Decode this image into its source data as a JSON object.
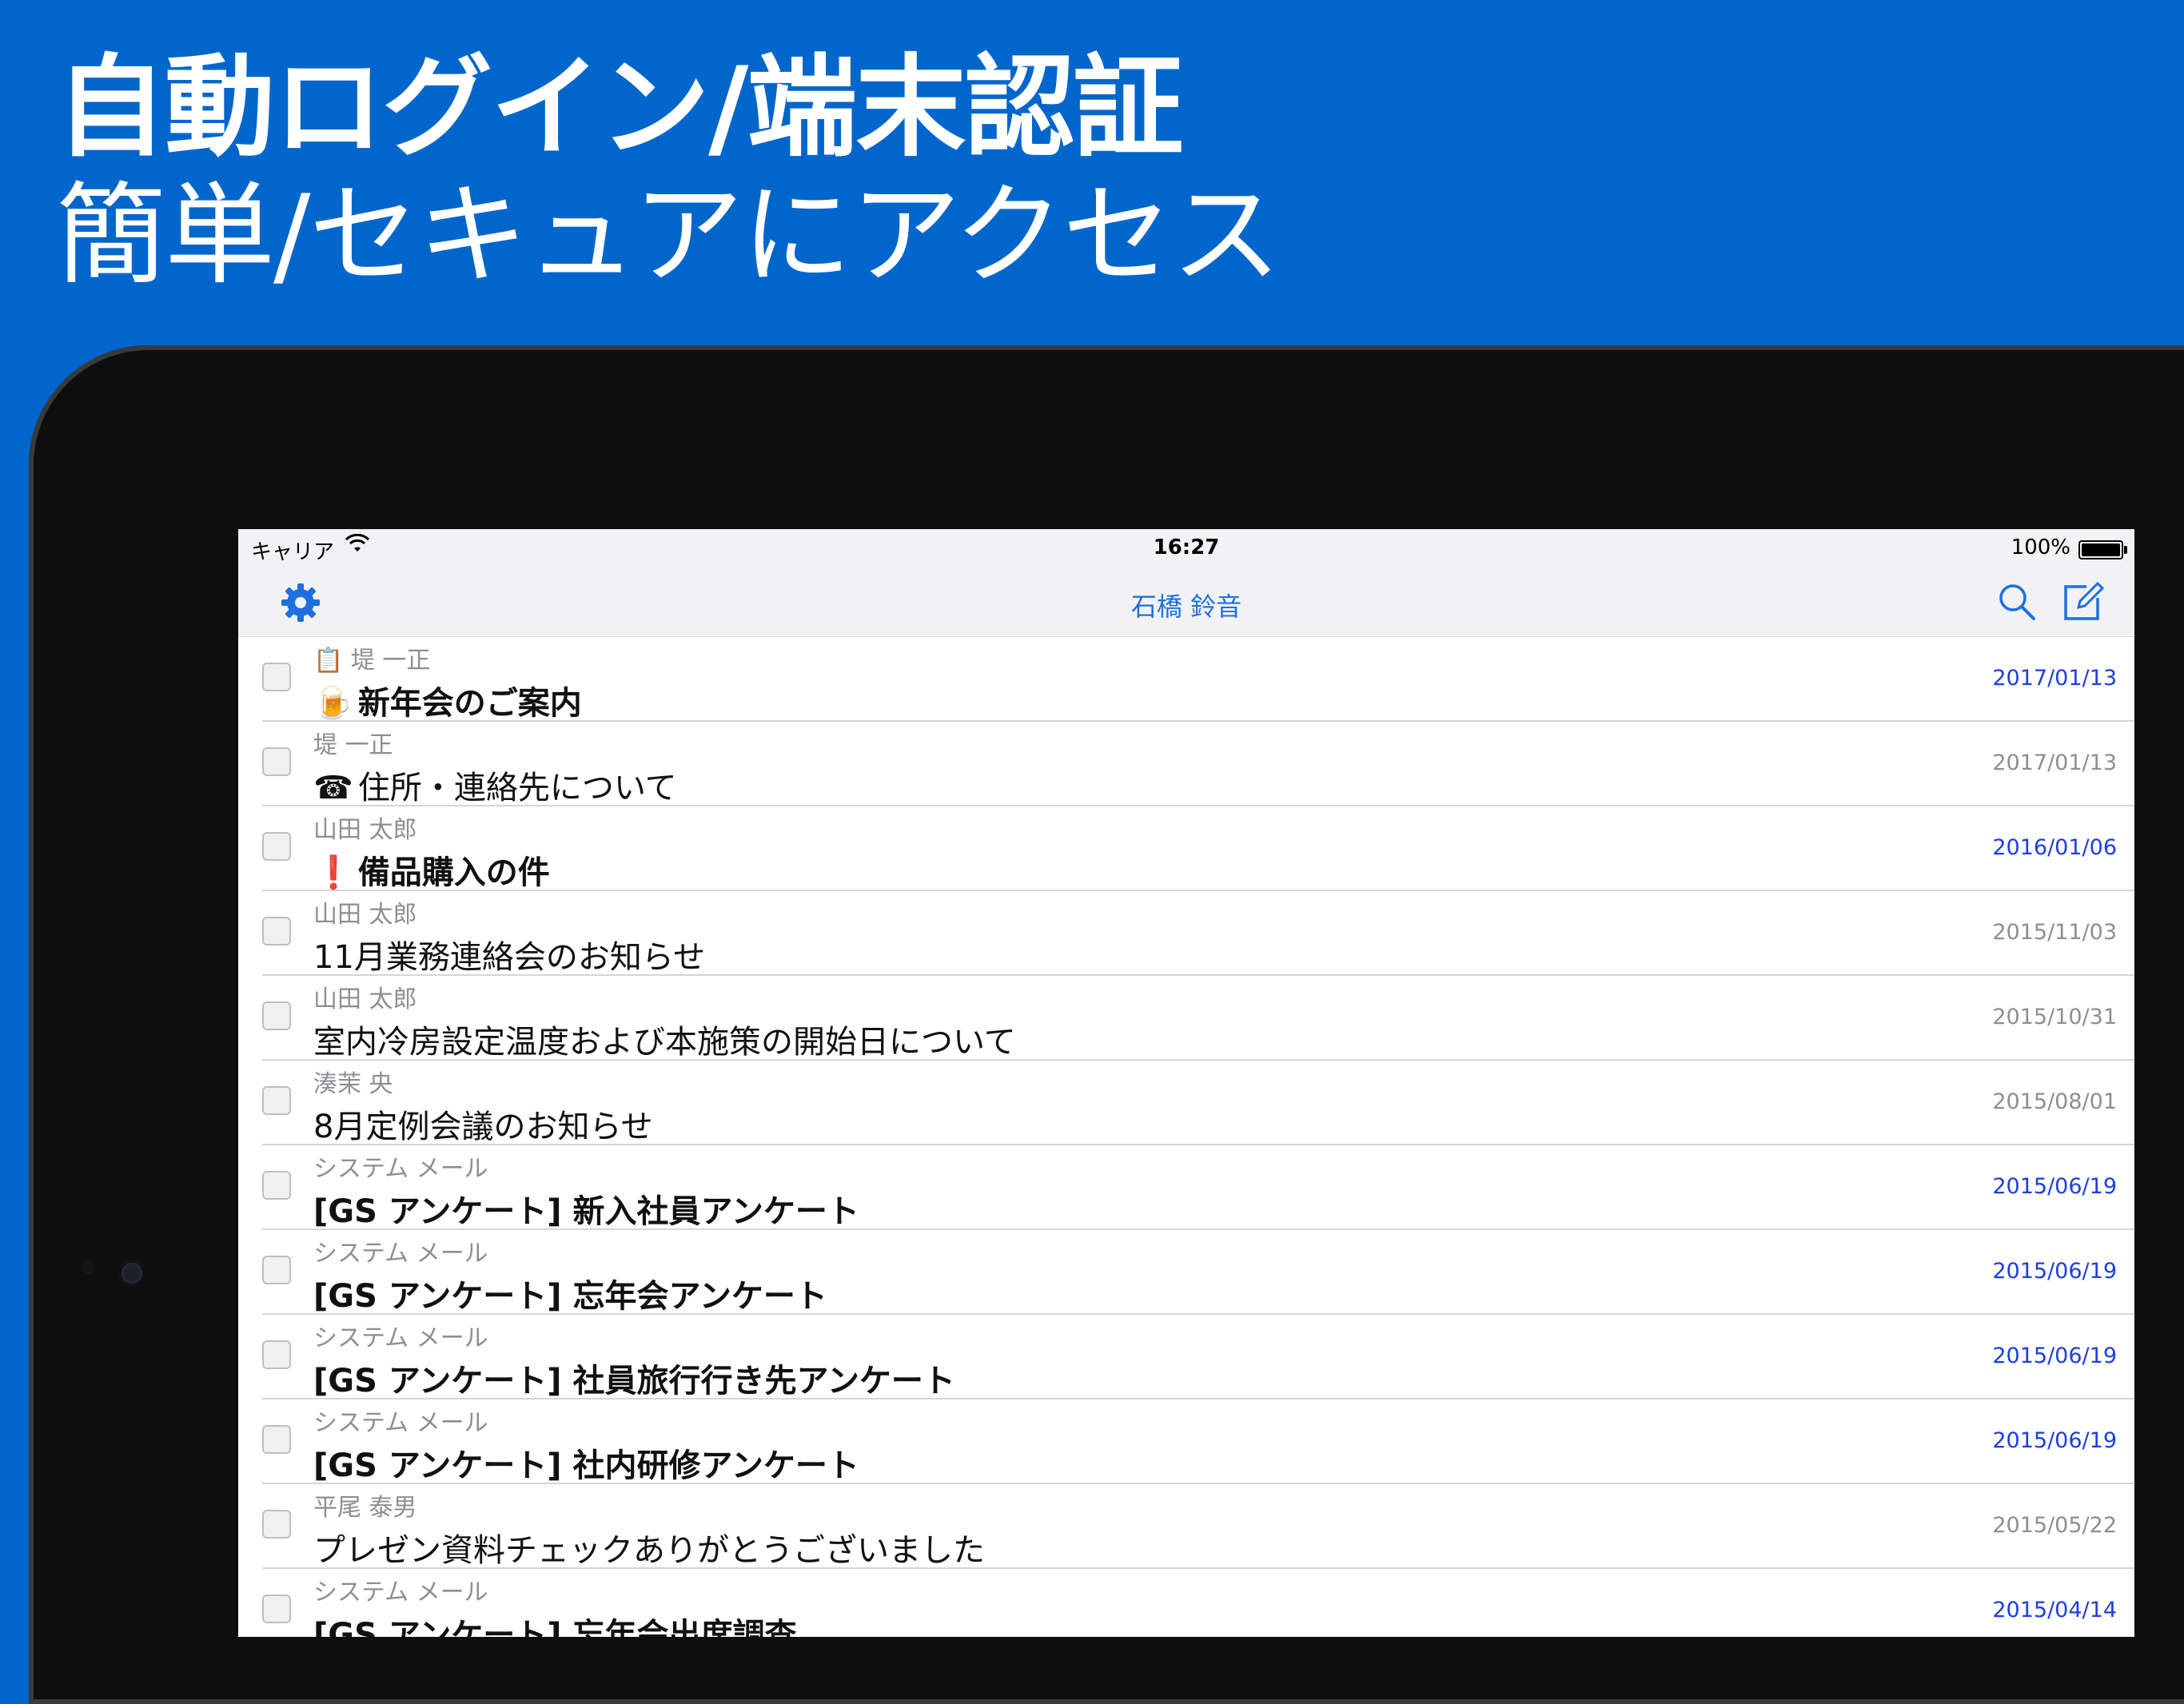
{
  "promo": {
    "line1": "自動ログイン/端末認証",
    "line2": "簡単/セキュアにアクセス"
  },
  "status_bar": {
    "carrier": "キャリア",
    "time": "16:27",
    "battery": "100%"
  },
  "nav": {
    "title": "石橋 鈴音"
  },
  "icons": {
    "settings": "gear-icon",
    "search": "search-icon",
    "compose": "compose-icon"
  },
  "colors": {
    "brand_blue": "#0066CC",
    "link_blue": "#1E6FE0",
    "new_date": "#1E3DE6"
  },
  "messages": [
    {
      "sender": "📋 堤 一正",
      "icon": "🍺",
      "subject": "新年会のご案内",
      "date": "2017/01/13",
      "unread": true
    },
    {
      "sender": "堤 一正",
      "icon": "☎",
      "subject": "住所・連絡先について",
      "date": "2017/01/13",
      "unread": false
    },
    {
      "sender": "山田 太郎",
      "icon": "❗",
      "subject": "備品購入の件",
      "date": "2016/01/06",
      "unread": true
    },
    {
      "sender": "山田 太郎",
      "icon": "",
      "subject": "11月業務連絡会のお知らせ",
      "date": "2015/11/03",
      "unread": false
    },
    {
      "sender": "山田 太郎",
      "icon": "",
      "subject": "室内冷房設定温度および本施策の開始日について",
      "date": "2015/10/31",
      "unread": false
    },
    {
      "sender": "湊茉 央",
      "icon": "",
      "subject": "8月定例会議のお知らせ",
      "date": "2015/08/01",
      "unread": false
    },
    {
      "sender": "システム メール",
      "icon": "",
      "subject": "[GS アンケート] 新入社員アンケート",
      "date": "2015/06/19",
      "unread": true
    },
    {
      "sender": "システム メール",
      "icon": "",
      "subject": "[GS アンケート] 忘年会アンケート",
      "date": "2015/06/19",
      "unread": true
    },
    {
      "sender": "システム メール",
      "icon": "",
      "subject": "[GS アンケート] 社員旅行行き先アンケート",
      "date": "2015/06/19",
      "unread": true
    },
    {
      "sender": "システム メール",
      "icon": "",
      "subject": "[GS アンケート] 社内研修アンケート",
      "date": "2015/06/19",
      "unread": true
    },
    {
      "sender": "平尾 泰男",
      "icon": "",
      "subject": "プレゼン資料チェックありがとうございました",
      "date": "2015/05/22",
      "unread": false
    },
    {
      "sender": "システム メール",
      "icon": "",
      "subject": "[GS アンケート] 忘年会出席調査",
      "date": "2015/04/14",
      "unread": true
    }
  ]
}
